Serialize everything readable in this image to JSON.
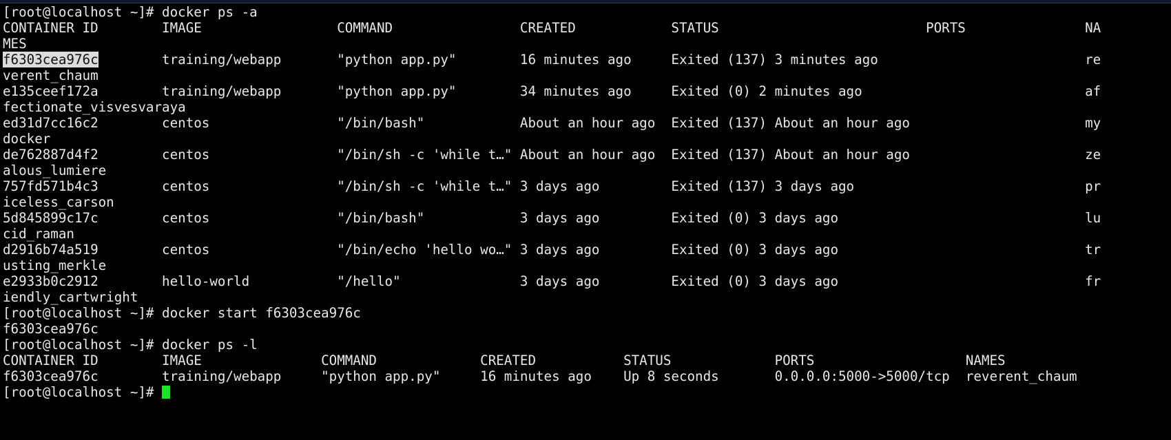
{
  "window": {
    "title_bar_color": "#101a2e",
    "background_color": "#000000",
    "foreground_color": "#e8e8e8",
    "selection_background": "#dcdcdc",
    "selection_foreground": "#111111",
    "cursor_color": "#1fe22b"
  },
  "prompt": "[root@localhost ~]# ",
  "commands": {
    "ps_all": "docker ps -a",
    "start": "docker start f6303cea976c",
    "ps_latest": "docker ps -l"
  },
  "ps_all_header": {
    "container_id": "CONTAINER ID",
    "image": "IMAGE",
    "command": "COMMAND",
    "created": "CREATED",
    "status": "STATUS",
    "ports": "PORTS",
    "names_part1": "NA",
    "names_part2": "MES"
  },
  "ps_all_rows": [
    {
      "container_id": "f6303cea976c",
      "selected": true,
      "image": "training/webapp",
      "command": "\"python app.py\"",
      "created": "16 minutes ago",
      "status": "Exited (137) 3 minutes ago",
      "ports": "",
      "names_part1": "re",
      "names_part2": "verent_chaum"
    },
    {
      "container_id": "e135ceef172a",
      "selected": false,
      "image": "training/webapp",
      "command": "\"python app.py\"",
      "created": "34 minutes ago",
      "status": "Exited (0) 2 minutes ago",
      "ports": "",
      "names_part1": "af",
      "names_part2": "fectionate_visvesvaraya"
    },
    {
      "container_id": "ed31d7cc16c2",
      "selected": false,
      "image": "centos",
      "command": "\"/bin/bash\"",
      "created": "About an hour ago",
      "status": "Exited (137) About an hour ago",
      "ports": "",
      "names_part1": "my",
      "names_part2": "docker"
    },
    {
      "container_id": "de762887d4f2",
      "selected": false,
      "image": "centos",
      "command": "\"/bin/sh -c 'while t…\"",
      "created": "About an hour ago",
      "status": "Exited (137) About an hour ago",
      "ports": "",
      "names_part1": "ze",
      "names_part2": "alous_lumiere"
    },
    {
      "container_id": "757fd571b4c3",
      "selected": false,
      "image": "centos",
      "command": "\"/bin/sh -c 'while t…\"",
      "created": "3 days ago",
      "status": "Exited (137) 3 days ago",
      "ports": "",
      "names_part1": "pr",
      "names_part2": "iceless_carson"
    },
    {
      "container_id": "5d845899c17c",
      "selected": false,
      "image": "centos",
      "command": "\"/bin/bash\"",
      "created": "3 days ago",
      "status": "Exited (0) 3 days ago",
      "ports": "",
      "names_part1": "lu",
      "names_part2": "cid_raman"
    },
    {
      "container_id": "d2916b74a519",
      "selected": false,
      "image": "centos",
      "command": "\"/bin/echo 'hello wo…\"",
      "created": "3 days ago",
      "status": "Exited (0) 3 days ago",
      "ports": "",
      "names_part1": "tr",
      "names_part2": "usting_merkle"
    },
    {
      "container_id": "e2933b0c2912",
      "selected": false,
      "image": "hello-world",
      "command": "\"/hello\"",
      "created": "3 days ago",
      "status": "Exited (0) 3 days ago",
      "ports": "",
      "names_part1": "fr",
      "names_part2": "iendly_cartwright"
    }
  ],
  "start_output": "f6303cea976c",
  "ps_latest_header": {
    "container_id": "CONTAINER ID",
    "image": "IMAGE",
    "command": "COMMAND",
    "created": "CREATED",
    "status": "STATUS",
    "ports": "PORTS",
    "names": "NAMES"
  },
  "ps_latest_row": {
    "container_id": "f6303cea976c",
    "image": "training/webapp",
    "command": "\"python app.py\"",
    "created": "16 minutes ago",
    "status": "Up 8 seconds",
    "ports": "0.0.0.0:5000->5000/tcp",
    "names": "reverent_chaum"
  }
}
